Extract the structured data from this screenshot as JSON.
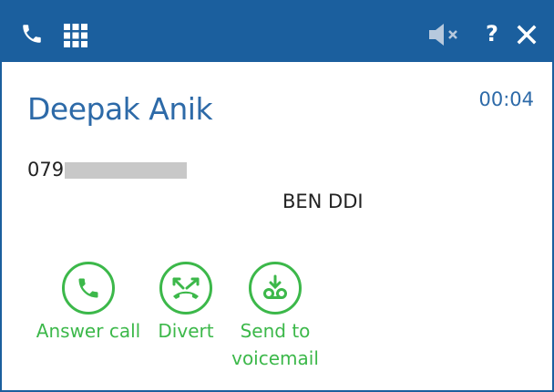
{
  "titlebar": {
    "phone_icon": "phone-icon",
    "keypad_icon": "keypad-icon",
    "mute_icon": "speaker-muted-icon",
    "help_label": "?",
    "close_icon": "close-icon",
    "background_color": "#1b5f9e"
  },
  "call": {
    "caller_name": "Deepak Anik",
    "duration": "00:04",
    "number_visible_prefix": "079",
    "line_label": "BEN DDI"
  },
  "actions": [
    {
      "label": "Answer call",
      "icon": "phone-answer-icon"
    },
    {
      "label": "Divert",
      "icon": "divert-icon"
    },
    {
      "label_line1": "Send to",
      "label_line2": "voicemail",
      "icon": "voicemail-download-icon"
    }
  ],
  "colors": {
    "accent_blue": "#2d6aa8",
    "action_green": "#3cb84a"
  }
}
